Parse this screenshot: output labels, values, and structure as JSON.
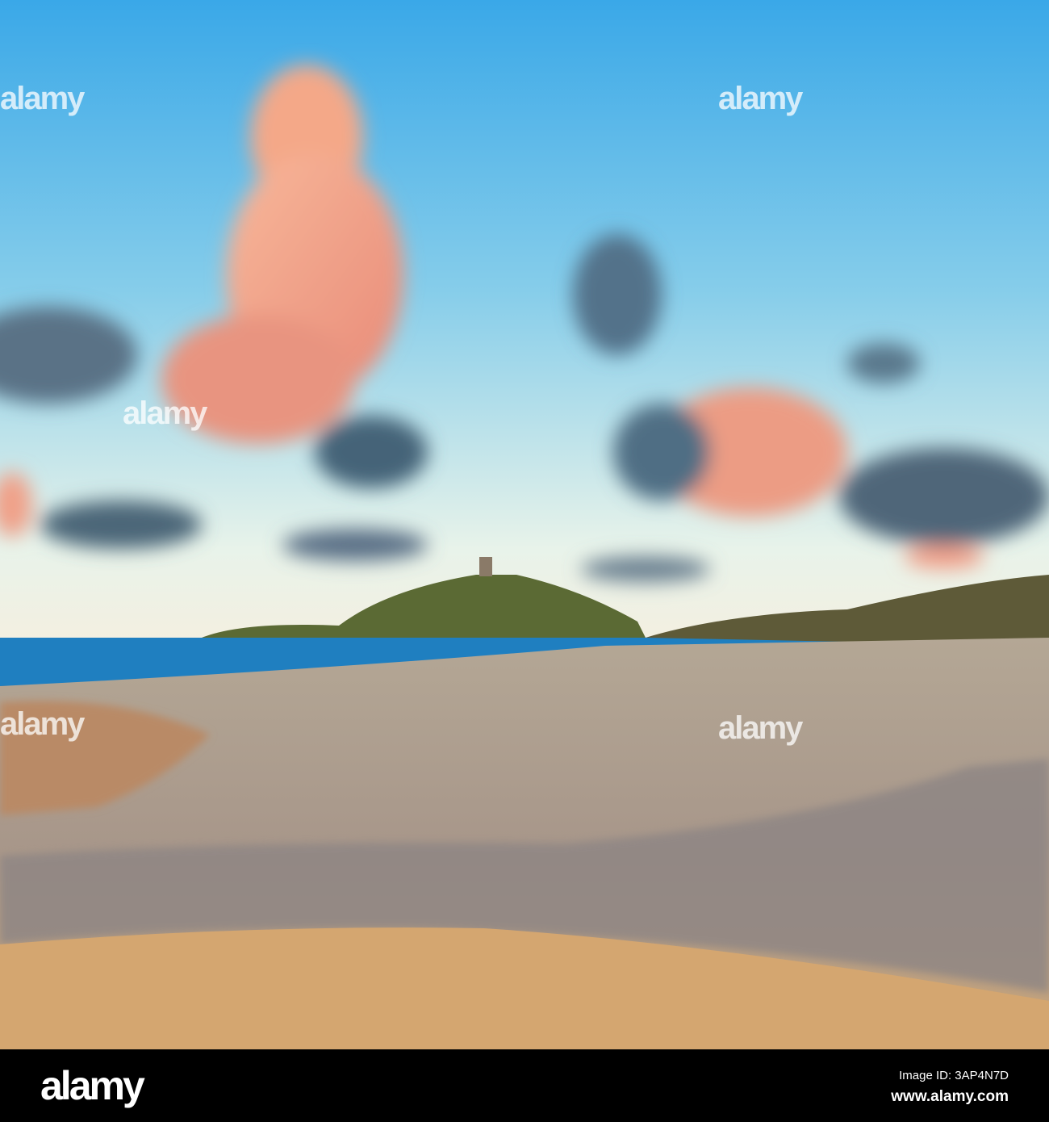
{
  "photo": {
    "subject": "Beach with sand, stream and hill with tower at sunset",
    "watermark": "alamy"
  },
  "footer": {
    "logo": "alamy",
    "image_id": "Image ID: 3AP4N7D",
    "website": "www.alamy.com"
  },
  "colors": {
    "sky_top": "#4ab0e8",
    "sky_bottom": "#e6f2ee",
    "sea": "#1f7fc0",
    "sand": "#b9a58e",
    "cloud_pink": "#f5a88a",
    "cloud_grey": "#4c6a80"
  }
}
